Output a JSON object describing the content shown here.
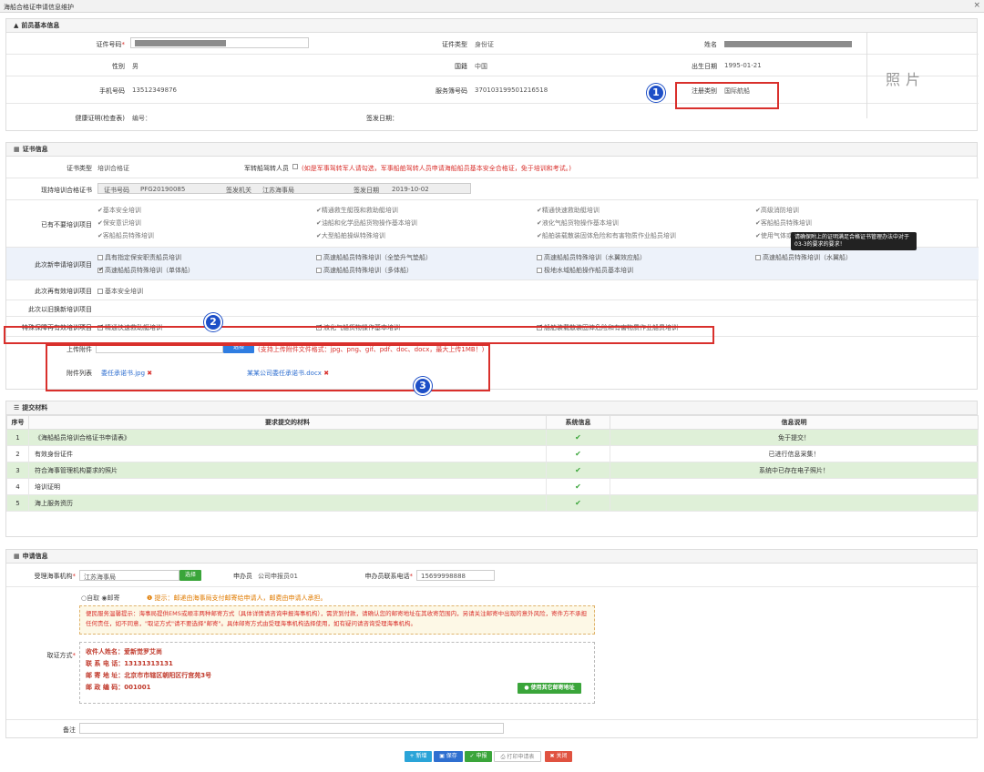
{
  "window": {
    "title": "海船合格证申请信息维护",
    "close": "×"
  },
  "basic": {
    "header": "前员基本信息",
    "id_no_label": "证件号码",
    "id_type_label": "证件类型",
    "id_type_value": "身份证",
    "name_label": "姓名",
    "gender_label": "性别",
    "gender_value": "男",
    "nation_label": "国籍",
    "nation_value": "中国",
    "birth_label": "出生日期",
    "birth_value": "1995-01-21",
    "phone_label": "手机号码",
    "phone_value": "13512349876",
    "service_label": "服务簿号码",
    "service_value": "370103199501216518",
    "reg_type_label": "注册类别",
    "reg_type_value": "国际航船",
    "health_label": "健康证明(检查表)",
    "health_no_label": "编号：",
    "issue_date_label": "签发日期：",
    "photo": "照片"
  },
  "cert": {
    "header": "证书信息",
    "type_label": "证书类型",
    "type_value": "培训合格证",
    "transfer_label": "军转船驾转人员",
    "transfer_note": "(如是军事驾转军人请勾选，军事船舶驾转人员申请海船船员基本安全合格证，免于培训和考试。)",
    "hold_label": "现持培训合格证书",
    "cert_no_label": "证书号码",
    "cert_no_value": "PFG20190085",
    "authority_label": "签发机关",
    "authority_value": "江苏海事局",
    "cert_date_label": "签发日期",
    "cert_date_value": "2019-10-02",
    "exempt_label": "已有不要培训项目",
    "exempt_items": [
      "基本安全培训",
      "精通救生艇筏和救助艇培训",
      "精通快速救助艇培训",
      "高级消防培训",
      "保安意识培训",
      "油船和化学品船货物操作基本培训",
      "液化气船货物操作基本培训",
      "客船船员特殊培训",
      "客船船员特殊培训",
      "大型船舶操纵特殊培训",
      "船舶装载散装固体危险和有害物质作业船员培训",
      "使用气体或其他"
    ],
    "tooltip": "请确保附上的证明满足合格证书管理办法中对于03-3的要求的要求！",
    "new_label": "此次新申请培训项目",
    "new_items": [
      {
        "t": "具有指定保安职责船员培训",
        "on": false
      },
      {
        "t": "高速船船员特殊培训（全垫升气垫船）",
        "on": false
      },
      {
        "t": "高速船船员特殊培训（水翼效应船）",
        "on": false
      },
      {
        "t": "高速船船员特殊培训（水翼船）",
        "on": false
      },
      {
        "t": "高速船船员特殊培训（单体船）",
        "on": true
      },
      {
        "t": "高速船船员特殊培训（多体船）",
        "on": false
      },
      {
        "t": "极地水域船舶操作船员基本培训",
        "on": false
      }
    ],
    "renew_label": "此次再有效培训项目",
    "renew_item": "基本安全培训",
    "old_label": "此次以旧换新培训项目",
    "special_label": "特殊保障再有效培训项目",
    "special_items": [
      "精通快速救助艇培训",
      "液化气船货物操作基本培训",
      "船舶装载散装固体危险和有害物质作业船员培训"
    ],
    "upload_label": "上传附件",
    "upload_btn": "选择",
    "upload_note": "(支持上传附件文件格式：jpg、png、gif、pdf、doc、docx，最大上传1MB！)",
    "files_label": "附件列表",
    "files": [
      "委任承诺书.jpg",
      "某某公司委任承诺书.docx"
    ],
    "file_x": "✖"
  },
  "materials": {
    "header": "提交材料",
    "cols": [
      "序号",
      "要求提交的材料",
      "系统信息",
      "信息说明"
    ],
    "rows": [
      {
        "no": "1",
        "name": "《海船船员培训合格证书申请表》",
        "info": "免于提交！"
      },
      {
        "no": "2",
        "name": "有效身份证件",
        "info": "已进行信息采集！"
      },
      {
        "no": "3",
        "name": "符合海事管理机构要求的照片",
        "info": "系统中已存在电子照片！"
      },
      {
        "no": "4",
        "name": "培训证明",
        "info": ""
      },
      {
        "no": "5",
        "name": "海上服务资历",
        "info": ""
      }
    ],
    "check": "✔"
  },
  "apply": {
    "header": "申请信息",
    "org_label": "受理海事机构",
    "org_value": "江苏海事局",
    "org_btn": "选择",
    "agent_label": "申办员",
    "agent_value": "公司申报员01",
    "agent_phone_label": "申办员联系电话",
    "agent_phone_value": "15699998888",
    "opt_self": "自取",
    "opt_mail": "邮寄",
    "hint": "❶ 提示：邮递由海事局支付邮寄给申请人，邮费由申请人承担。",
    "notice": "便民服务温馨提示：海事局提供EMS或顺丰两种邮寄方式（具体详情请咨询申报海事机构），需货到付款，请确认您的邮寄地址在其收寄范围内，另请关注邮寄中出现的意外风险，寄件方不承担任何责任，如不同意，\"取证方式\"请不要选择\"邮寄\"。具体邮寄方式由受理海事机构选择使用，如有疑问请咨询受理海事机构。",
    "pickup_label": "取证方式",
    "recv_name": "收件人姓名：爱新觉罗艾尚",
    "recv_phone": "联 系 电 话：13131313131",
    "recv_addr": "邮 寄 地 址：北京市市辖区朝阳区行宫苑3号",
    "recv_zip": "邮 政 编 码：001001",
    "other_addr_btn": "使用其它邮寄地址",
    "remark_label": "备注"
  },
  "actions": {
    "add": "新增",
    "save": "保存",
    "apply": "申报",
    "print": "打印申请表",
    "close": "关闭"
  },
  "badges": [
    "1",
    "2",
    "3"
  ],
  "colors": {
    "accent": "#1d4fc7",
    "highlight": "#d9302c",
    "green": "#3aa53a"
  }
}
